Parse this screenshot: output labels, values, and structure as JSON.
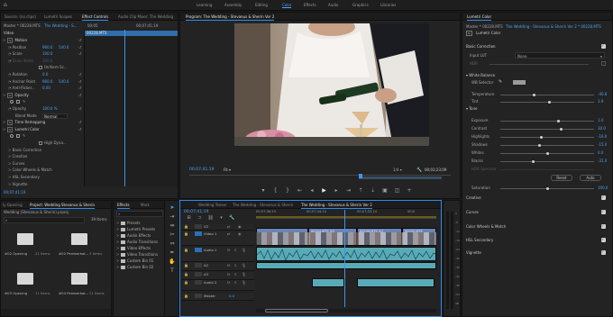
{
  "workspaces": [
    "Learning",
    "Assembly",
    "Editing",
    "Color",
    "Effects",
    "Audio",
    "Graphics",
    "Libraries"
  ],
  "active_workspace_index": 3,
  "source_tabs": {
    "tab1": "Source: (no clips)",
    "tab2": "Lumetri Scopes",
    "tab3": "Effect Controls",
    "tab4": "Audio Clip Mixer: The Wedding"
  },
  "effect_controls": {
    "master_label": "Master * 00228.MTS",
    "sequence_label": "The Wedding - S...",
    "timecode_start": "00;05",
    "timecode_end": "00;07;41;19",
    "clip_label": "00228.MTS",
    "video_header": "Video",
    "current_timecode": "00;07;41;19",
    "rows": [
      {
        "name": "Motion",
        "value": "",
        "kind": "fx"
      },
      {
        "name": "Position",
        "value": "960.0",
        "value2": "540.0",
        "kind": "param"
      },
      {
        "name": "Scale",
        "value": "100.0",
        "value2": "",
        "kind": "param"
      },
      {
        "name": "Scale Width",
        "value": "100.0",
        "value2": "",
        "kind": "dim"
      },
      {
        "name": "",
        "value": "Uniform Sc...",
        "value2": "",
        "kind": "check"
      },
      {
        "name": "Rotation",
        "value": "0.0",
        "value2": "",
        "kind": "param"
      },
      {
        "name": "Anchor Point",
        "value": "960.0",
        "value2": "540.0",
        "kind": "param"
      },
      {
        "name": "Anti-flicker...",
        "value": "0.00",
        "value2": "",
        "kind": "param"
      },
      {
        "name": "Opacity",
        "value": "",
        "kind": "fx"
      },
      {
        "name": "",
        "value": "",
        "kind": "shapes"
      },
      {
        "name": "Opacity",
        "value": "100.0 %",
        "value2": "",
        "kind": "param"
      },
      {
        "name": "Blend Mode",
        "value": "Normal",
        "value2": "",
        "kind": "select"
      },
      {
        "name": "Time Remapping",
        "value": "",
        "kind": "fx"
      },
      {
        "name": "Lumetri Color",
        "value": "",
        "kind": "fx"
      },
      {
        "name": "",
        "value": "",
        "kind": "shapes"
      },
      {
        "name": "",
        "value": "High Dyna...",
        "value2": "",
        "kind": "check"
      },
      {
        "name": "Basic Correction",
        "value": "",
        "kind": "sub"
      },
      {
        "name": "Creative",
        "value": "",
        "kind": "sub"
      },
      {
        "name": "Curves",
        "value": "",
        "kind": "sub"
      },
      {
        "name": "Color Wheels & Match",
        "value": "",
        "kind": "sub"
      },
      {
        "name": "HSL Secondary",
        "value": "",
        "kind": "sub"
      },
      {
        "name": "Vignette",
        "value": "",
        "kind": "sub"
      }
    ]
  },
  "program": {
    "tab": "Program: The Wedding - Stevanus & Sherin Ver 2",
    "timecode": "00;07;41;19",
    "fit": "Fit",
    "resolution": "1/4",
    "duration": "00;03;23;09"
  },
  "project": {
    "tabs": [
      "ly Opening",
      "Project: Wedding Stevanus & Sherin",
      "Effects",
      "Mark"
    ],
    "path": "Wedding (Stevanus & Sherin).prproj",
    "count": "39 Items",
    "items": [
      {
        "name": "#02 Opening",
        "count": "21 Items"
      },
      {
        "name": "#02 Pemberkat...",
        "count": "3 Items"
      },
      {
        "name": "#03 Opening",
        "count": "11 Items"
      },
      {
        "name": "#04 Pemberkat...",
        "count": "21 Items"
      }
    ]
  },
  "effects": {
    "items": [
      "Presets",
      "Lumetri Presets",
      "Audio Effects",
      "Audio Transitions",
      "Video Effects",
      "Video Transitions",
      "Custom Bin 01",
      "Custom Bin 02"
    ]
  },
  "timeline": {
    "tabs": [
      "Wedding Teaser",
      "The Wedding - Stevanus & Sherin",
      "The Wedding - Stevanus & Sherin Ver 2"
    ],
    "timecode": "00;07;41;19",
    "ruler": [
      "00;07;36;14",
      "00;07;44;14",
      "00;07;52;14",
      "00;0"
    ],
    "clip_labels": [
      "00244.MTS [V]",
      "00239.MTS [V]",
      "00232.MTS"
    ],
    "tracks": [
      {
        "id": "V2",
        "label": "V2"
      },
      {
        "id": "V1",
        "label": "Video 1"
      },
      {
        "id": "A1",
        "label": "Audio 1"
      },
      {
        "id": "A2",
        "label": "A2"
      },
      {
        "id": "A3",
        "label": "A3"
      },
      {
        "id": "A4",
        "label": "Audio 2"
      },
      {
        "id": "Master",
        "label": "Master"
      }
    ],
    "master_value": "0.0",
    "meter_labels": [
      "0",
      "-6",
      "-12",
      "-18",
      "-24",
      "-30",
      "-36",
      "-42",
      "-48",
      "-54",
      "dB"
    ]
  },
  "lumetri": {
    "tab": "Lumetri Color",
    "master_label": "Master * 00228.MTS",
    "sequence_label": "The Wedding - Stevanus & Sherin Ver 2 * 00228.MTS",
    "fx_label": "Lumetri Color",
    "basic_correction": "Basic Correction",
    "input_lut_label": "Input LUT",
    "input_lut_value": "None",
    "hdr_label": "HDR",
    "white_balance": "White Balance",
    "wb_selector": "WB Selector",
    "tone": "Tone",
    "auto": "Auto",
    "reset": "Reset",
    "params": [
      {
        "name": "Temperature",
        "value": "-40.8",
        "pos": 0.36
      },
      {
        "name": "Tint",
        "value": "3.9",
        "pos": 0.52
      },
      {
        "name": "Exposure",
        "value": "1.0",
        "pos": 0.62
      },
      {
        "name": "Contrast",
        "value": "30.0",
        "pos": 0.65
      },
      {
        "name": "Highlights",
        "value": "-16.0",
        "pos": 0.44
      },
      {
        "name": "Shadows",
        "value": "-15.0",
        "pos": 0.42
      },
      {
        "name": "Whites",
        "value": "0.0",
        "pos": 0.5
      },
      {
        "name": "Blacks",
        "value": "-31.0",
        "pos": 0.35
      },
      {
        "name": "HDR Specular",
        "value": "",
        "pos": 0.5
      },
      {
        "name": "Saturation",
        "value": "100.0",
        "pos": 0.5
      }
    ],
    "sections": [
      "Creative",
      "Curves",
      "Color Wheels & Match",
      "HSL Secondary",
      "Vignette"
    ]
  }
}
